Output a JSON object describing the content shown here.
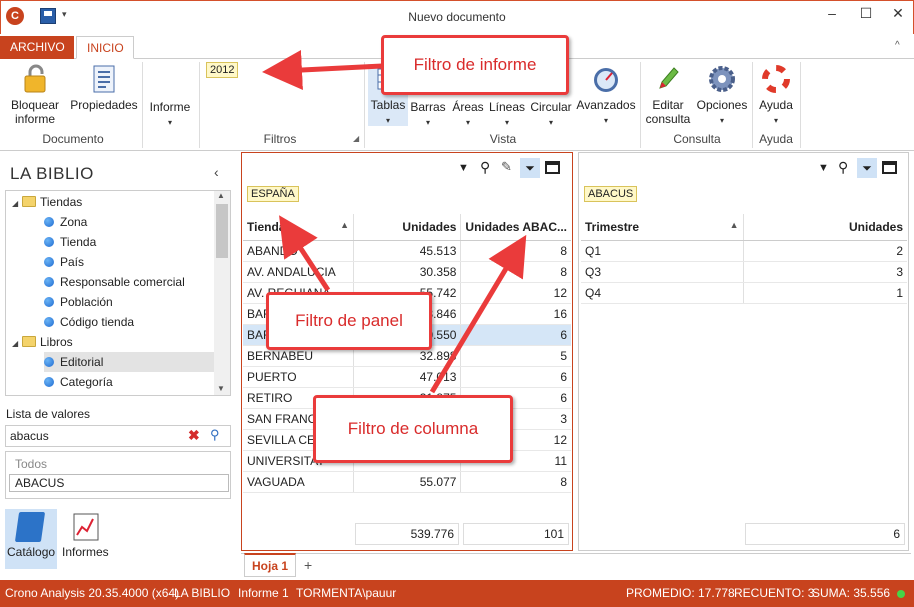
{
  "window": {
    "title": "Nuevo documento"
  },
  "tabs": {
    "archivo": "ARCHIVO",
    "inicio": "INICIO"
  },
  "ribbon": {
    "bloquear": [
      "Bloquear",
      "informe"
    ],
    "propiedades": "Propiedades",
    "documento": "Documento",
    "informe": "Informe",
    "filter_chip": "2012",
    "filtros": "Filtros",
    "tablas": "Tablas",
    "barras": "Barras",
    "areas": "Áreas",
    "lineas": "Líneas",
    "circular": "Circular",
    "avanzados": "Avanzados",
    "vista": "Vista",
    "editar": [
      "Editar",
      "consulta"
    ],
    "opciones": "Opciones",
    "consulta": "Consulta",
    "ayuda_btn": "Ayuda",
    "ayuda_group": "Ayuda"
  },
  "left": {
    "title": "LA BIBLIO",
    "tree": [
      {
        "label": "Tiendas",
        "type": "folder",
        "level": 0
      },
      {
        "label": "Zona",
        "type": "item",
        "level": 1
      },
      {
        "label": "Tienda",
        "type": "item",
        "level": 1
      },
      {
        "label": "País",
        "type": "item",
        "level": 1
      },
      {
        "label": "Responsable comercial",
        "type": "item",
        "level": 1
      },
      {
        "label": "Población",
        "type": "item",
        "level": 1
      },
      {
        "label": "Código tienda",
        "type": "item",
        "level": 1
      },
      {
        "label": "Libros",
        "type": "folder",
        "level": 0
      },
      {
        "label": "Editorial",
        "type": "item",
        "level": 1,
        "selected": true
      },
      {
        "label": "Categoría",
        "type": "item",
        "level": 1
      }
    ],
    "values_label": "Lista de valores",
    "search_value": "abacus",
    "values": [
      "Todos",
      "ABACUS"
    ],
    "catalogo": "Catálogo",
    "informes": "Informes"
  },
  "panel1": {
    "chip": "ESPAÑA",
    "headers": [
      "Tienda",
      "Unidades",
      "Unidades ABAC..."
    ],
    "rows": [
      [
        "ABANDO",
        "45.513",
        "8"
      ],
      [
        "AV. ANDALUCIA",
        "30.358",
        "8"
      ],
      [
        "AV. REGUIANA",
        "55.742",
        "12"
      ],
      [
        "BARAKALDO",
        "63.846",
        "16"
      ],
      [
        "BARCELONA",
        "50.550",
        "6"
      ],
      [
        "BERNABEU",
        "32.898",
        "5"
      ],
      [
        "PUERTO",
        "47.013",
        "6"
      ],
      [
        "RETIRO",
        "31.875",
        "6"
      ],
      [
        "SAN FRANCISCO",
        "",
        "3"
      ],
      [
        "SEVILLA CENTRO",
        "",
        "12"
      ],
      [
        "UNIVERSITAT",
        "",
        "11"
      ],
      [
        "VAGUADA",
        "55.077",
        "8"
      ]
    ],
    "totals": [
      "539.776",
      "101"
    ]
  },
  "panel2": {
    "chip": "ABACUS",
    "headers": [
      "Trimestre",
      "Unidades"
    ],
    "rows": [
      [
        "Q1",
        "2"
      ],
      [
        "Q3",
        "3"
      ],
      [
        "Q4",
        "1"
      ]
    ],
    "total": "6"
  },
  "bottom": {
    "sheet": "Hoja 1",
    "add": "+"
  },
  "status": {
    "app": "Crono Analysis 20.35.4000 (x64)",
    "biblio": "LA BIBLIO",
    "informe": "Informe 1",
    "user": "TORMENTA\\pauur",
    "promedio": "PROMEDIO: 17.778",
    "recuento": "RECUENTO: 3",
    "suma": "SUMA: 35.556"
  },
  "callouts": {
    "informe": "Filtro de informe",
    "panel": "Filtro de panel",
    "columna": "Filtro de columna"
  },
  "colors": {
    "accent": "#c8431e",
    "callout": "#ea3b3b",
    "chip": "#fff8c8"
  }
}
